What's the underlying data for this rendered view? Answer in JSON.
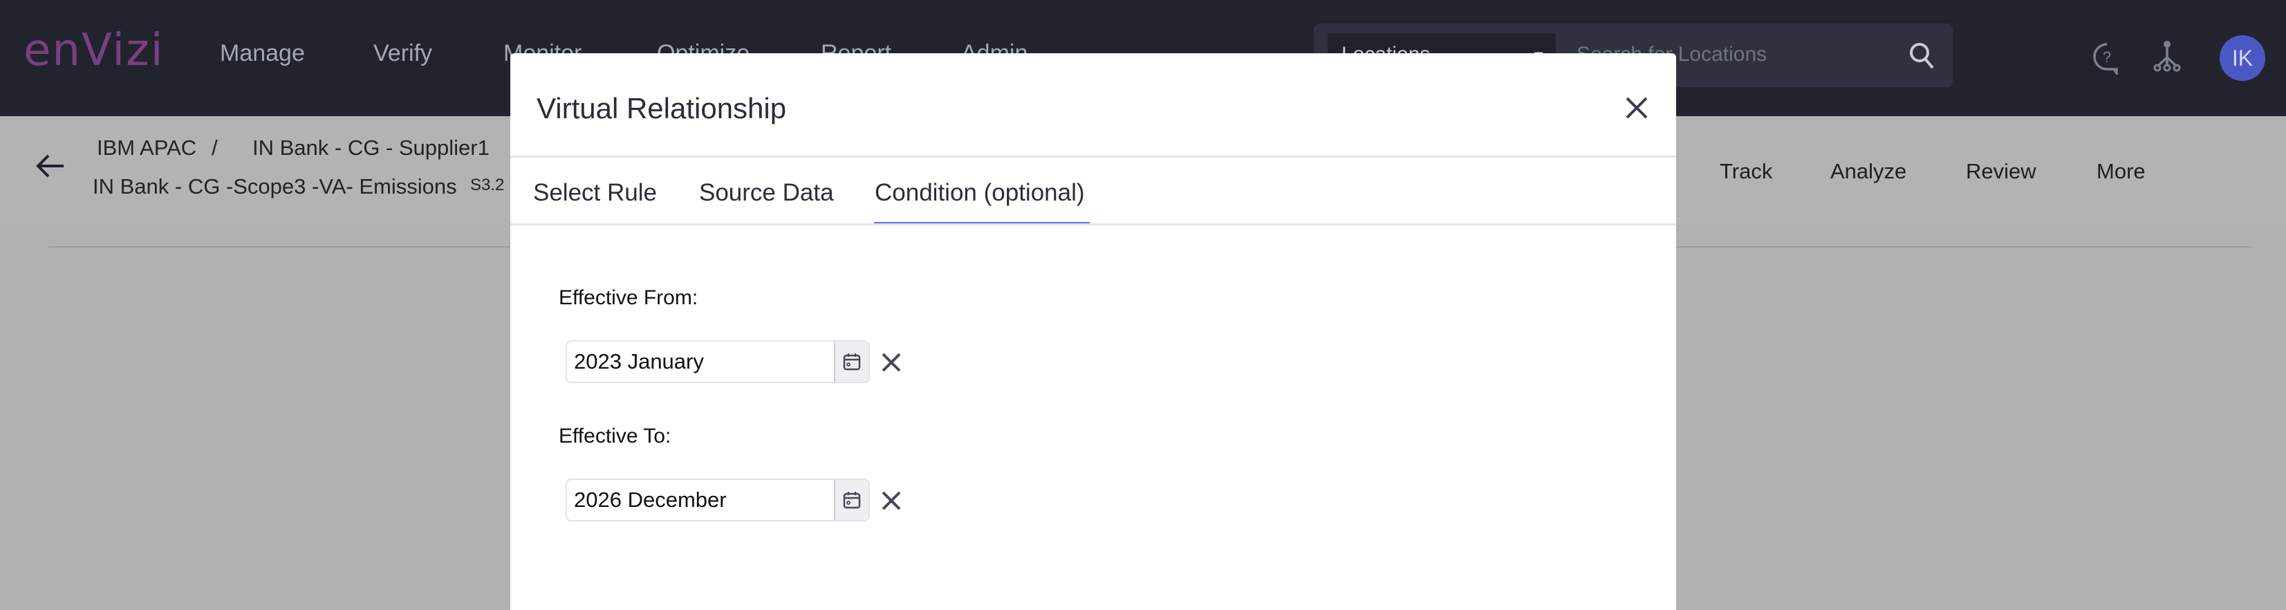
{
  "header": {
    "logo": "enVizi",
    "nav": [
      "Manage",
      "Verify",
      "Monitor",
      "Optimize",
      "Report",
      "Admin"
    ],
    "search": {
      "scope": "Locations",
      "placeholder": "Search for Locations"
    },
    "avatar": "IK"
  },
  "subheader": {
    "breadcrumb": [
      "IBM APAC",
      "/",
      "IN Bank - CG - Supplier1"
    ],
    "title": "IN Bank - CG -Scope3 -VA- Emissions",
    "code": "S3.2",
    "actions": [
      "Track",
      "Analyze",
      "Review",
      "More"
    ]
  },
  "modal": {
    "title": "Virtual Relationship",
    "tabs": [
      "Select Rule",
      "Source Data",
      "Condition (optional)"
    ],
    "active_tab": "Condition (optional)",
    "from": {
      "label": "Effective From:",
      "value": "2023 January"
    },
    "to": {
      "label": "Effective To:",
      "value": "2026 December"
    }
  },
  "colors": {
    "accent": "#6274f0",
    "header": "#21242d",
    "avatar": "#4b58c4",
    "logo": "#7a3f82"
  }
}
